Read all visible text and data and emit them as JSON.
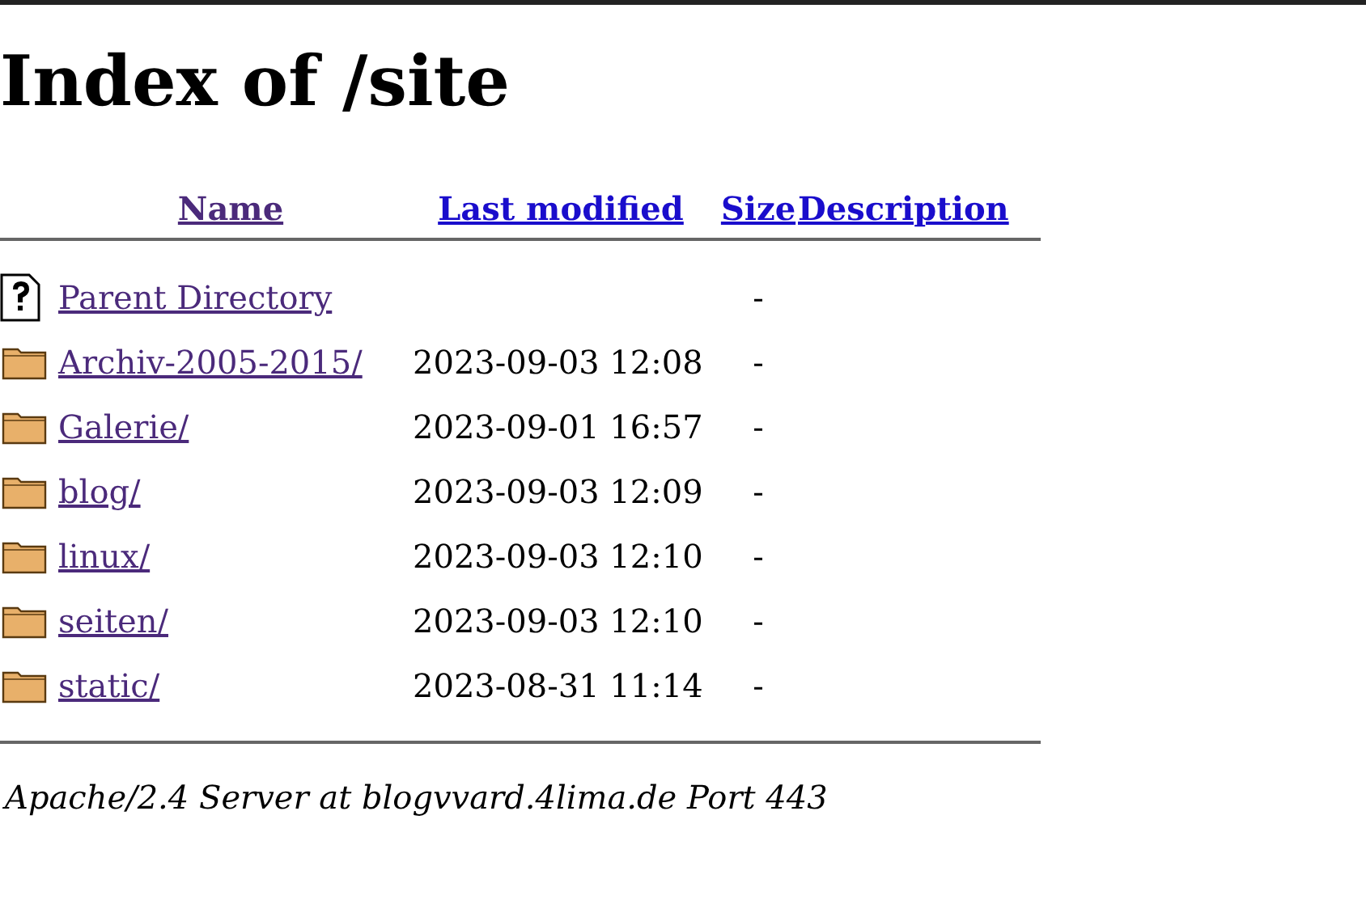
{
  "title": "Index of /site",
  "columns": [
    {
      "label": "Name",
      "visited": true
    },
    {
      "label": "Last modified",
      "visited": false
    },
    {
      "label": "Size",
      "visited": false
    },
    {
      "label": "Description",
      "visited": false
    }
  ],
  "rows": [
    {
      "kind": "parent",
      "name": "Parent Directory",
      "visited": true,
      "modified": "",
      "size": "-"
    },
    {
      "kind": "folder",
      "name": "Archiv-2005-2015/",
      "visited": true,
      "modified": "2023-09-03 12:08",
      "size": "-"
    },
    {
      "kind": "folder",
      "name": "Galerie/",
      "visited": true,
      "modified": "2023-09-01 16:57",
      "size": "-"
    },
    {
      "kind": "folder",
      "name": "blog/",
      "visited": true,
      "modified": "2023-09-03 12:09",
      "size": "-"
    },
    {
      "kind": "folder",
      "name": "linux/",
      "visited": true,
      "modified": "2023-09-03 12:10",
      "size": "-"
    },
    {
      "kind": "folder",
      "name": "seiten/",
      "visited": true,
      "modified": "2023-09-03 12:10",
      "size": "-"
    },
    {
      "kind": "folder",
      "name": "static/",
      "visited": true,
      "modified": "2023-08-31 11:14",
      "size": "-"
    }
  ],
  "footer": "Apache/2.4 Server at blogvvard.4lima.de Port 443"
}
